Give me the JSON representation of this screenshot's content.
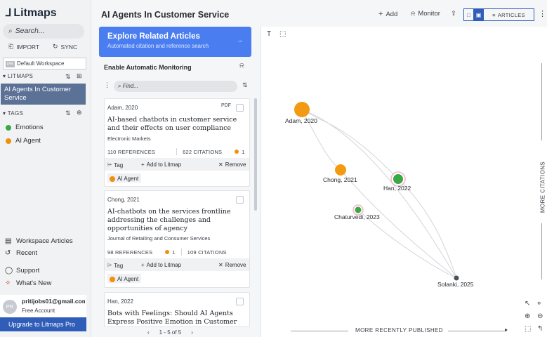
{
  "app": {
    "name": "Litmaps",
    "logo_mark": "⅃"
  },
  "sidebar": {
    "search_placeholder": "Search...",
    "import_label": "IMPORT",
    "sync_label": "SYNC",
    "workspace_badge": "PR",
    "workspace_name": "Default Workspace",
    "litmaps_header": "LITMAPS",
    "litmap_active": "AI Agents In Customer Service",
    "tags_header": "TAGS",
    "tags": [
      {
        "label": "Emotions",
        "color": "#3aa845"
      },
      {
        "label": "AI Agent",
        "color": "#f0900b"
      }
    ],
    "workspace_articles": "Workspace Articles",
    "recent": "Recent",
    "support": "Support",
    "whats_new": "What's New",
    "account": {
      "initials": "PR",
      "email": "pritijobs01@gmail.com",
      "plan": "Free Account"
    },
    "upgrade_label": "Upgrade to Litmaps Pro"
  },
  "topbar": {
    "title": "AI Agents In Customer Service",
    "add_label": "Add",
    "monitor_label": "Monitor",
    "view_label": "ARTICLES"
  },
  "panel": {
    "explore_title": "Explore Related Articles",
    "explore_sub": "Automated citation and reference search",
    "explore_arrow": "→",
    "monitoring_label": "Enable Automatic Monitoring",
    "find_placeholder": "Find...",
    "pagination": {
      "prev": "‹",
      "text": "1 - 5 of 5",
      "next": "›"
    },
    "cards": [
      {
        "author": "Adam, 2020",
        "has_pdf": true,
        "title": "AI-based chatbots in customer service and their effects on user compliance",
        "venue": "Electronic Markets",
        "references": "110 REFERENCES",
        "citations": "622 CITATIONS",
        "tag_count": "1",
        "tag_label": "Tag",
        "add_label": "Add to Litmap",
        "remove_label": "Remove",
        "tag": "AI Agent"
      },
      {
        "author": "Chong, 2021",
        "has_pdf": false,
        "title": "AI-chatbots on the services frontline addressing the challenges and opportunities of agency",
        "venue": "Journal of Retailing and Consumer Services",
        "references": "98 REFERENCES",
        "citations": "109 CITATIONS",
        "tag_count": "1",
        "tag_label": "Tag",
        "add_label": "Add to Litmap",
        "remove_label": "Remove",
        "tag": "AI Agent"
      },
      {
        "author": "Han, 2022",
        "has_pdf": false,
        "title": "Bots with Feelings: Should AI Agents Express Positive Emotion in Customer"
      }
    ]
  },
  "graph": {
    "y_axis_label": "MORE CITATIONS",
    "x_axis_label": "MORE RECENTLY PUBLISHED",
    "nodes": [
      {
        "label": "Adam, 2020",
        "color": "#f39a13",
        "size": "large"
      },
      {
        "label": "Chong, 2021",
        "color": "#f39a13",
        "size": "medium"
      },
      {
        "label": "Han, 2022",
        "color": "#3aa845",
        "size": "medium",
        "ring": "#f2b6c8"
      },
      {
        "label": "Chaturvedi, 2023",
        "color": "#3aa845",
        "size": "small",
        "ring": "#f2b6c8"
      },
      {
        "label": "Solanki, 2025",
        "color": "#4b4f57",
        "size": "tiny"
      }
    ]
  },
  "colors": {
    "accent": "#2f5db8",
    "explore_bg": "#4a7ef0",
    "litmap_active_bg": "#5b7196",
    "tag_orange": "#f0900b",
    "tag_green": "#3aa845"
  }
}
